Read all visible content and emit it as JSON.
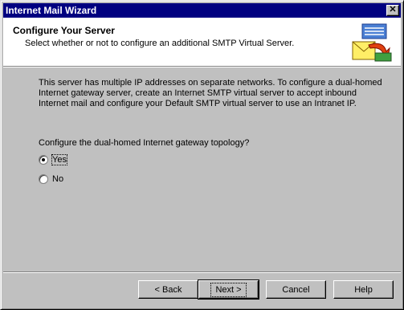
{
  "window": {
    "title": "Internet Mail Wizard",
    "close_glyph": "✕"
  },
  "header": {
    "title": "Configure Your Server",
    "subtitle": "Select whether or not to configure an additional SMTP Virtual Server.",
    "icon": "mail-wizard-icon"
  },
  "body": {
    "description": "This server has multiple IP addresses on separate networks. To configure a dual-homed Internet gateway server, create an Internet SMTP virtual server to accept inbound Internet mail and configure your Default SMTP virtual server to use an Intranet IP.",
    "question": "Configure the dual-homed Internet gateway topology?",
    "options": [
      {
        "label": "Yes",
        "selected": true
      },
      {
        "label": "No",
        "selected": false
      }
    ]
  },
  "buttons": {
    "back": "< Back",
    "next": "Next >",
    "cancel": "Cancel",
    "help": "Help"
  }
}
